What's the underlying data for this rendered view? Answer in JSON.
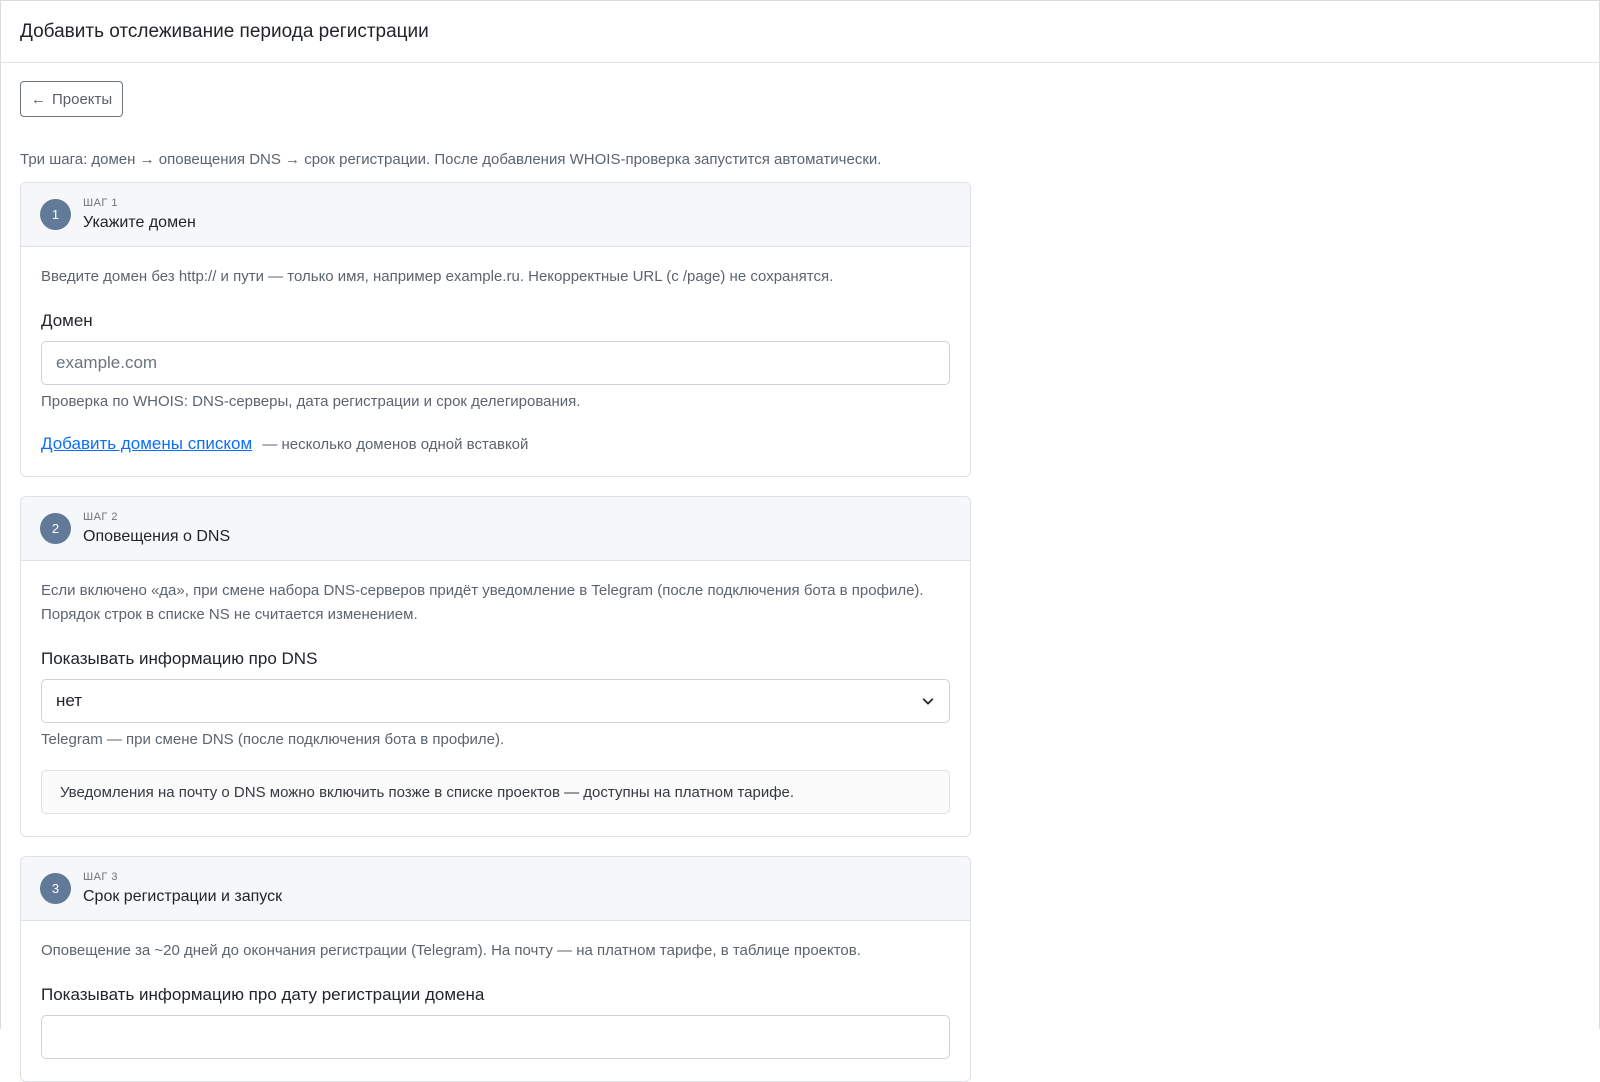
{
  "header": {
    "title": "Добавить отслеживание периода регистрации"
  },
  "back_button": {
    "label": "Проекты",
    "icon": "arrow-left-icon"
  },
  "intro": "Три шага: домен → оповещения DNS → срок регистрации. После добавления WHOIS-проверка запустится автоматически.",
  "steps": [
    {
      "number": "1",
      "label": "ШАГ 1",
      "title": "Укажите домен",
      "help": "Введите домен без http:// и пути — только имя, например example.ru. Некорректные URL (с /page) не сохранятся.",
      "field_label": "Домен",
      "input_placeholder": "example.com",
      "below": "Проверка по WHOIS: DNS-серверы, дата регистрации и срок делегирования.",
      "link": "Добавить домены списком",
      "link_suffix": "— несколько доменов одной вставкой"
    },
    {
      "number": "2",
      "label": "ШАГ 2",
      "title": "Оповещения о DNS",
      "help_line1": "Если включено «да», при смене набора DNS-серверов придёт уведомление в Telegram (после подключения бота в профиле).",
      "help_line2": "Порядок строк в списке NS не считается изменением.",
      "field_label": "Показывать информацию про DNS",
      "select_value": "нет",
      "below": "Telegram — при смене DNS (после подключения бота в профиле).",
      "notice": "Уведомления на почту о DNS можно включить позже в списке проектов — доступны на платном тарифе."
    },
    {
      "number": "3",
      "label": "ШАГ 3",
      "title": "Срок регистрации и запуск",
      "help": "Оповещение за ~20 дней до окончания регистрации (Telegram). На почту — на платном тарифе, в таблице проектов.",
      "field_label": "Показывать информацию про дату регистрации домена"
    }
  ],
  "colors": {
    "step_badge": "#607a97",
    "link": "#0d6efd"
  }
}
